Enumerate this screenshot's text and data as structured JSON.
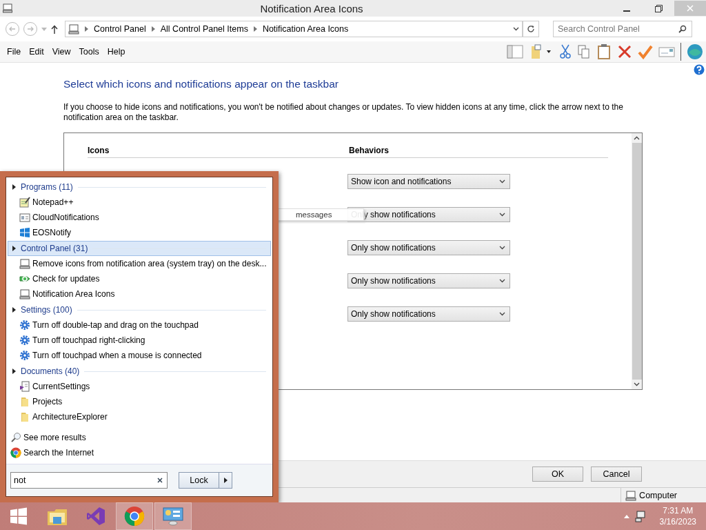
{
  "window": {
    "title": "Notification Area Icons"
  },
  "address_bar": {
    "breadcrumbs": [
      "Control Panel",
      "All Control Panel Items",
      "Notification Area Icons"
    ]
  },
  "search": {
    "placeholder": "Search Control Panel"
  },
  "menu": [
    "File",
    "Edit",
    "View",
    "Tools",
    "Help"
  ],
  "content": {
    "heading": "Select which icons and notifications appear on the taskbar",
    "description": "If you choose to hide icons and notifications, you won't be notified about changes or updates. To view hidden icons at any time, click the arrow next to the notification area on the taskbar.",
    "columns": [
      "Icons",
      "Behaviors"
    ],
    "behaviors": [
      "Show icon and notifications",
      "Only show notifications",
      "Only show notifications",
      "Only show notifications",
      "Only show notifications"
    ]
  },
  "buttons": [
    "OK",
    "Cancel"
  ],
  "status_bar": {
    "text": "Computer"
  },
  "tooltip": {
    "text": "messages"
  },
  "start_menu": {
    "groups": [
      {
        "label": "Programs (11)",
        "selected": false,
        "items": [
          {
            "label": "Notepad++",
            "kind": "notepad"
          },
          {
            "label": "CloudNotifications",
            "kind": "app"
          },
          {
            "label": "EOSNotify",
            "kind": "windows"
          }
        ]
      },
      {
        "label": "Control Panel (31)",
        "selected": true,
        "items": [
          {
            "label": "Remove icons from notification area (system tray) on the desk...",
            "kind": "computer"
          },
          {
            "label": "Check for updates",
            "kind": "update"
          },
          {
            "label": "Notification Area Icons",
            "kind": "computer"
          }
        ]
      },
      {
        "label": "Settings (100)",
        "selected": false,
        "items": [
          {
            "label": "Turn off double-tap and drag on the touchpad",
            "kind": "gear"
          },
          {
            "label": "Turn off touchpad right-clicking",
            "kind": "gear"
          },
          {
            "label": "Turn off touchpad when a mouse is connected",
            "kind": "gear"
          }
        ]
      },
      {
        "label": "Documents (40)",
        "selected": false,
        "items": [
          {
            "label": "CurrentSettings",
            "kind": "document"
          },
          {
            "label": "Projects",
            "kind": "folder"
          },
          {
            "label": "ArchitectureExplorer",
            "kind": "folder"
          }
        ]
      }
    ],
    "links": [
      {
        "label": "See more results",
        "kind": "search"
      },
      {
        "label": "Search the Internet",
        "kind": "browser"
      }
    ],
    "search": {
      "value": "not"
    },
    "power_button": "Lock"
  },
  "taskbar": {
    "apps": [
      {
        "kind": "windows",
        "selected": false
      },
      {
        "kind": "explorer",
        "selected": false
      },
      {
        "kind": "studio",
        "selected": false
      },
      {
        "kind": "browser",
        "selected": true
      },
      {
        "kind": "control",
        "selected": true
      }
    ],
    "time": "7:31 AM",
    "date": "3/16/2023"
  }
}
